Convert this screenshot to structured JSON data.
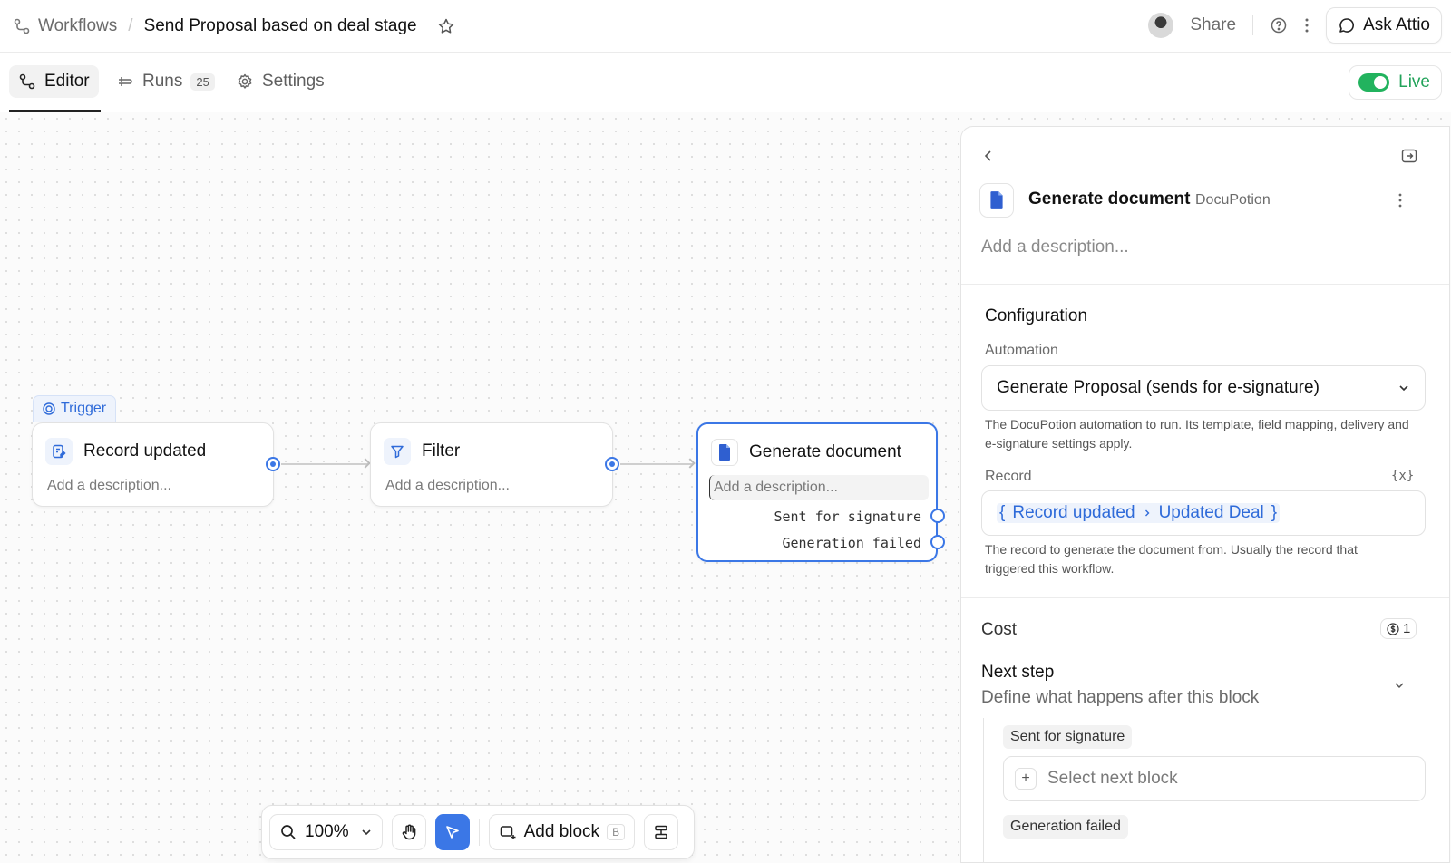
{
  "breadcrumb": {
    "root": "Workflows",
    "separator": "/",
    "title": "Send Proposal based on deal stage"
  },
  "header": {
    "share": "Share",
    "ask": "Ask Attio"
  },
  "tabs": [
    {
      "label": "Editor",
      "active": true
    },
    {
      "label": "Runs",
      "badge": "25"
    },
    {
      "label": "Settings"
    }
  ],
  "status": {
    "live_label": "Live",
    "live_on": true
  },
  "canvas": {
    "trigger_tag": "Trigger",
    "nodes": [
      {
        "title": "Record updated",
        "description": "Add a description..."
      },
      {
        "title": "Filter",
        "description": "Add a description..."
      },
      {
        "title": "Generate document",
        "description": "Add a description...",
        "outputs": [
          "Sent for signature",
          "Generation failed"
        ]
      }
    ]
  },
  "toolbar": {
    "zoom": "100%",
    "add_block": "Add block",
    "add_block_shortcut": "B"
  },
  "panel": {
    "title": "Generate document",
    "app": "DocuPotion",
    "description_placeholder": "Add a description...",
    "configuration": "Configuration",
    "automation_label": "Automation",
    "automation_value": "Generate Proposal (sends for e-signature)",
    "automation_help": "The DocuPotion automation to run. Its template, field mapping, delivery and e-signature settings apply.",
    "record_label": "Record",
    "record_var_icon": "{x}",
    "record_open": "{",
    "record_source": "Record updated",
    "record_field": "Updated Deal",
    "record_close": "}",
    "record_help": "The record to generate the document from. Usually the record that triggered this workflow.",
    "cost_label": "Cost",
    "cost_value": "1",
    "next_step_title": "Next step",
    "next_step_sub": "Define what happens after this block",
    "branches": [
      {
        "label": "Sent for signature",
        "placeholder": "Select next block"
      },
      {
        "label": "Generation failed"
      }
    ]
  },
  "colors": {
    "accent": "#3b77e6",
    "live": "#22b35e",
    "doc_icon": "#2f5fd0"
  }
}
